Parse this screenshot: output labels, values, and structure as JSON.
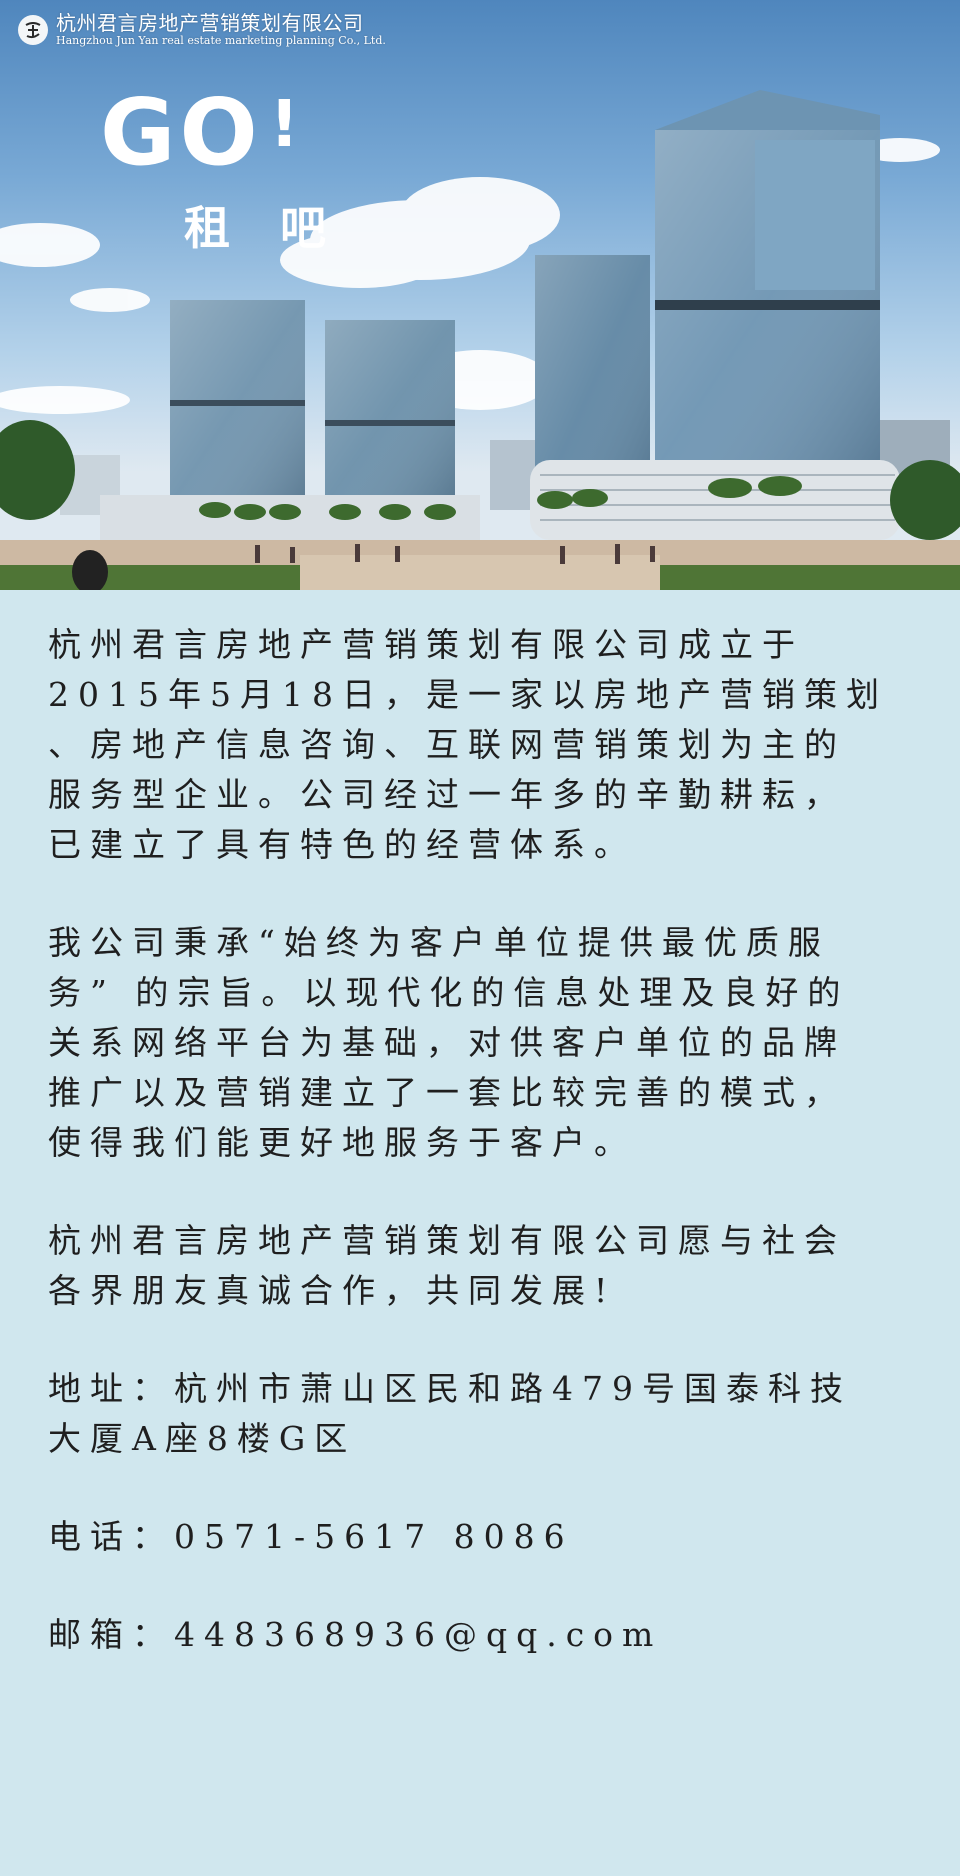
{
  "header": {
    "company_name_cn": "杭州君言房地产营销策划有限公司",
    "company_name_en": "Hangzhou Jun Yan real estate marketing planning Co., Ltd.",
    "logo_icon": "company-seal-logo"
  },
  "hero": {
    "headline": "GO",
    "headline_mark": "!",
    "subheadline": "租吧",
    "image": "office-towers-rendering"
  },
  "content": {
    "intro": "杭州君言房地产营销策划有限公司成立于\n2015年5月18日，是一家以房地产营销策划\n、房地产信息咨询、互联网营销策划为主的\n服务型企业。公司经过一年多的辛勤耕耘，\n已建立了具有特色的经营体系。",
    "mission": "我公司秉承“始终为客户单位提供最优质服\n务” 的宗旨。以现代化的信息处理及良好的\n关系网络平台为基础，对供客户单位的品牌\n推广以及营销建立了一套比较完善的模式，\n使得我们能更好地服务于客户。",
    "closing": "杭州君言房地产营销策划有限公司愿与社会\n各界朋友真诚合作，共同发展!",
    "address": "地址：杭州市萧山区民和路479号国泰科技\n大厦A座8楼G区",
    "phone": "电话：0571-5617 8086",
    "email": "邮箱：448368936@qq.com"
  },
  "colors": {
    "background": "#d0e7ee",
    "text": "#1f1f1f",
    "headline": "#ffffff"
  }
}
